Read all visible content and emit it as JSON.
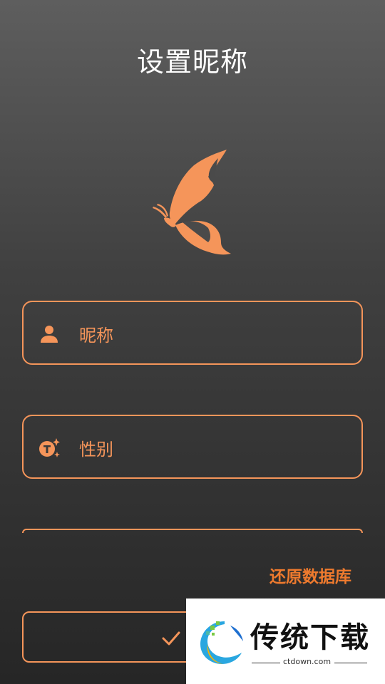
{
  "header": {
    "title": "设置昵称"
  },
  "form": {
    "nickname_placeholder": "昵称",
    "gender_placeholder": "性别"
  },
  "actions": {
    "restore_db_label": "还原数据库",
    "confirm_icon": "check-icon"
  },
  "watermark": {
    "brand": "传统下载",
    "domain": "ctdown.com"
  },
  "colors": {
    "accent": "#f5955a",
    "restore_text": "#ee7a2e",
    "title_text": "#ffffff"
  }
}
